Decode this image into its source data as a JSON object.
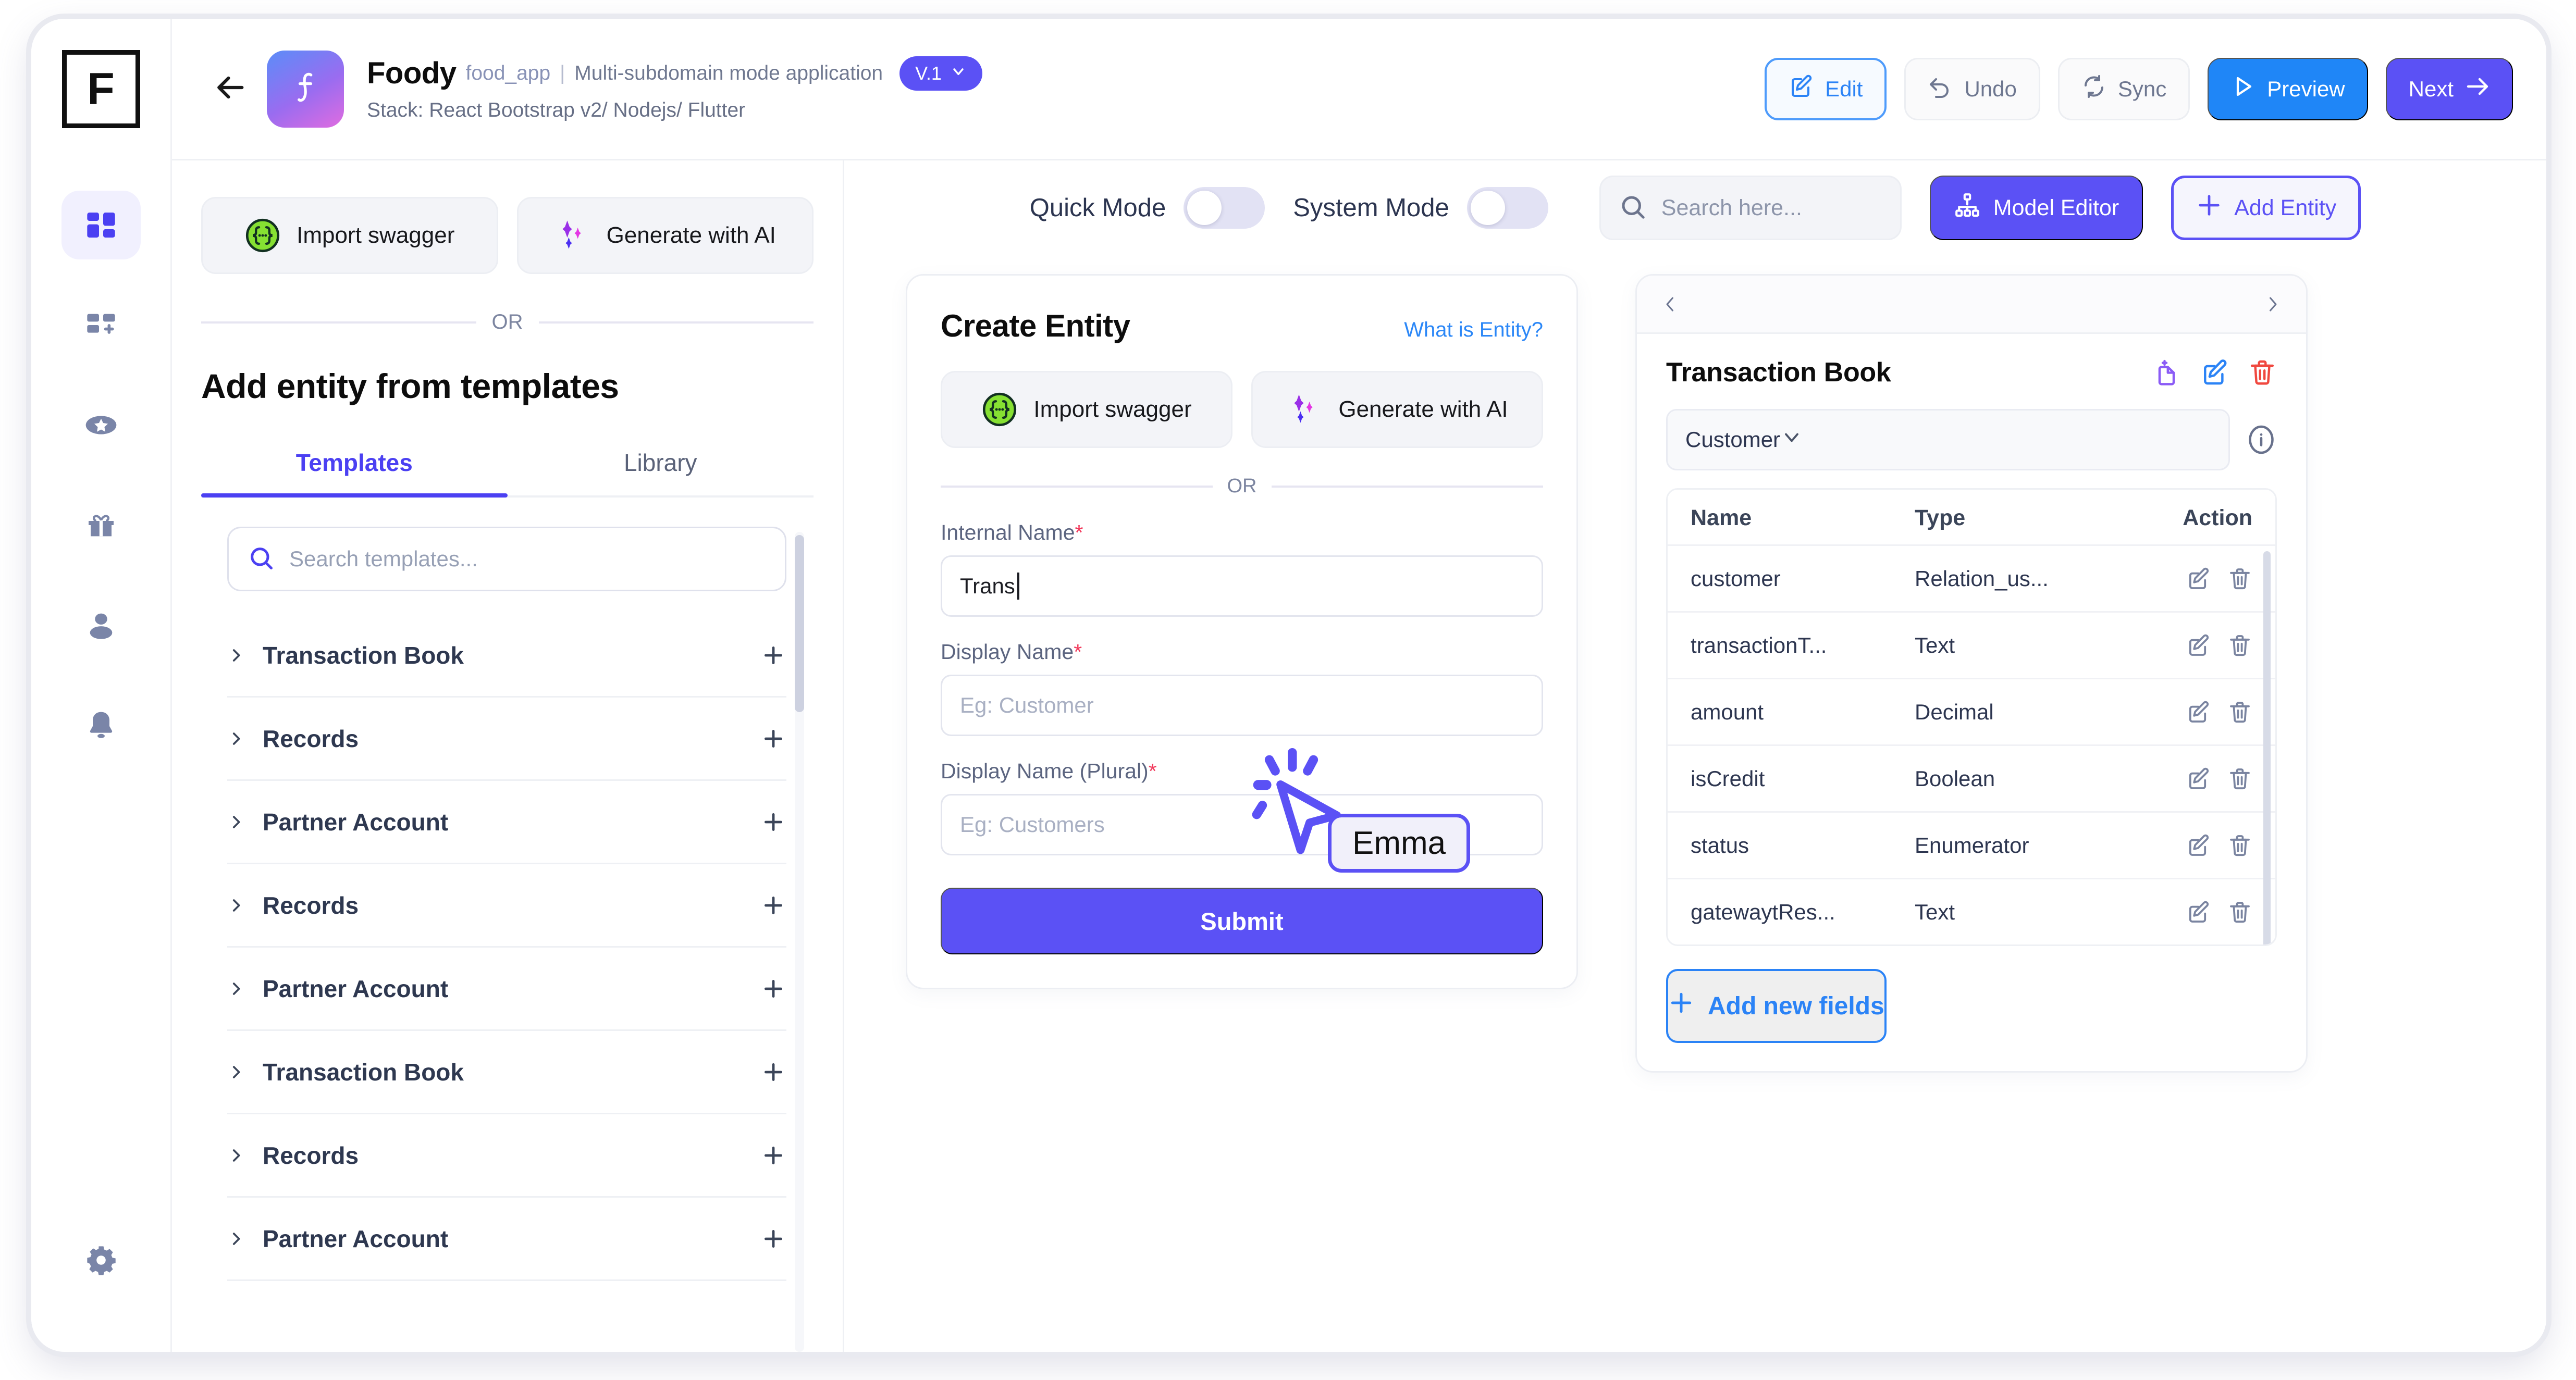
{
  "sidebar": {
    "logo_letter": "F",
    "items": [
      {
        "name": "dashboard-icon",
        "active": true
      },
      {
        "name": "add-dashboard-icon",
        "active": false
      },
      {
        "name": "star-icon",
        "active": false
      },
      {
        "name": "gift-icon",
        "active": false
      },
      {
        "name": "user-icon",
        "active": false
      },
      {
        "name": "bell-icon",
        "active": false
      }
    ],
    "settings": {
      "name": "gear-icon"
    }
  },
  "topbar": {
    "back_icon": "arrow-left-icon",
    "app_name": "Foody",
    "app_slug": "food_app",
    "separator": "|",
    "app_mode": "Multi-subdomain mode application",
    "version": "V.1",
    "stack": "Stack: React Bootstrap v2/ Nodejs/ Flutter",
    "actions": [
      {
        "label": "Edit",
        "icon": "edit-square-icon",
        "style": "outline-blue"
      },
      {
        "label": "Undo",
        "icon": "undo-arrow-icon",
        "style": "ghost"
      },
      {
        "label": "Sync",
        "icon": "sync-icon",
        "style": "ghost"
      },
      {
        "label": "Preview",
        "icon": "play-icon",
        "style": "solid-blue"
      },
      {
        "label": "Next",
        "icon": "arrow-right-icon",
        "style": "solid-indigo"
      }
    ]
  },
  "left_panel": {
    "import_swagger": "Import swagger",
    "generate_ai": "Generate with AI",
    "or": "OR",
    "section_title": "Add entity from templates",
    "tabs": [
      {
        "label": "Templates",
        "active": true
      },
      {
        "label": "Library",
        "active": false
      }
    ],
    "search_placeholder": "Search templates...",
    "templates": [
      {
        "label": "Transaction Book"
      },
      {
        "label": "Records"
      },
      {
        "label": "Partner Account"
      },
      {
        "label": "Records"
      },
      {
        "label": "Partner Account"
      },
      {
        "label": "Transaction Book"
      },
      {
        "label": "Records"
      },
      {
        "label": "Partner Account"
      }
    ]
  },
  "workspace": {
    "quick_mode_label": "Quick Mode",
    "quick_mode_on": false,
    "system_mode_label": "System Mode",
    "system_mode_on": false,
    "search_placeholder": "Search here...",
    "model_editor": "Model Editor",
    "add_entity": "Add Entity"
  },
  "create_entity": {
    "title": "Create Entity",
    "help_link": "What is Entity?",
    "import_swagger": "Import swagger",
    "generate_ai": "Generate with AI",
    "or": "OR",
    "fields": [
      {
        "label": "Internal Name",
        "required": "*",
        "value": "Trans",
        "placeholder": ""
      },
      {
        "label": "Display Name",
        "required": "*",
        "value": "",
        "placeholder": "Eg: Customer"
      },
      {
        "label": "Display Name (Plural)",
        "required": "*",
        "value": "",
        "placeholder": "Eg: Customers"
      }
    ],
    "submit": "Submit"
  },
  "entity_panel": {
    "prev_icon": "chevron-left-icon",
    "next_icon": "chevron-right-icon",
    "title": "Transaction Book",
    "actions": [
      {
        "name": "clone-icon",
        "color": "#8b5cf6"
      },
      {
        "name": "edit-icon",
        "color": "#2b83f6"
      },
      {
        "name": "delete-icon",
        "color": "#f0483f"
      }
    ],
    "selected_entity": "Customer",
    "info_icon": "info-icon",
    "table": {
      "columns": [
        "Name",
        "Type",
        "Action"
      ],
      "rows": [
        {
          "name": "customer",
          "type": "Relation_us..."
        },
        {
          "name": "transactionT...",
          "type": "Text"
        },
        {
          "name": "amount",
          "type": "Decimal"
        },
        {
          "name": "isCredit",
          "type": "Boolean"
        },
        {
          "name": "status",
          "type": "Enumerator"
        },
        {
          "name": "gatewaytRes...",
          "type": "Text"
        }
      ],
      "row_actions": [
        "edit-icon",
        "delete-icon"
      ]
    },
    "add_new_fields": "Add new fields"
  },
  "remote_cursor": {
    "name": "Emma",
    "accent": "#5b51f5"
  },
  "colors": {
    "indigo": "#5b51f5",
    "blue": "#2b83f6",
    "red": "#f0483f",
    "purple": "#8b5cf6",
    "green": "#7ed321"
  }
}
